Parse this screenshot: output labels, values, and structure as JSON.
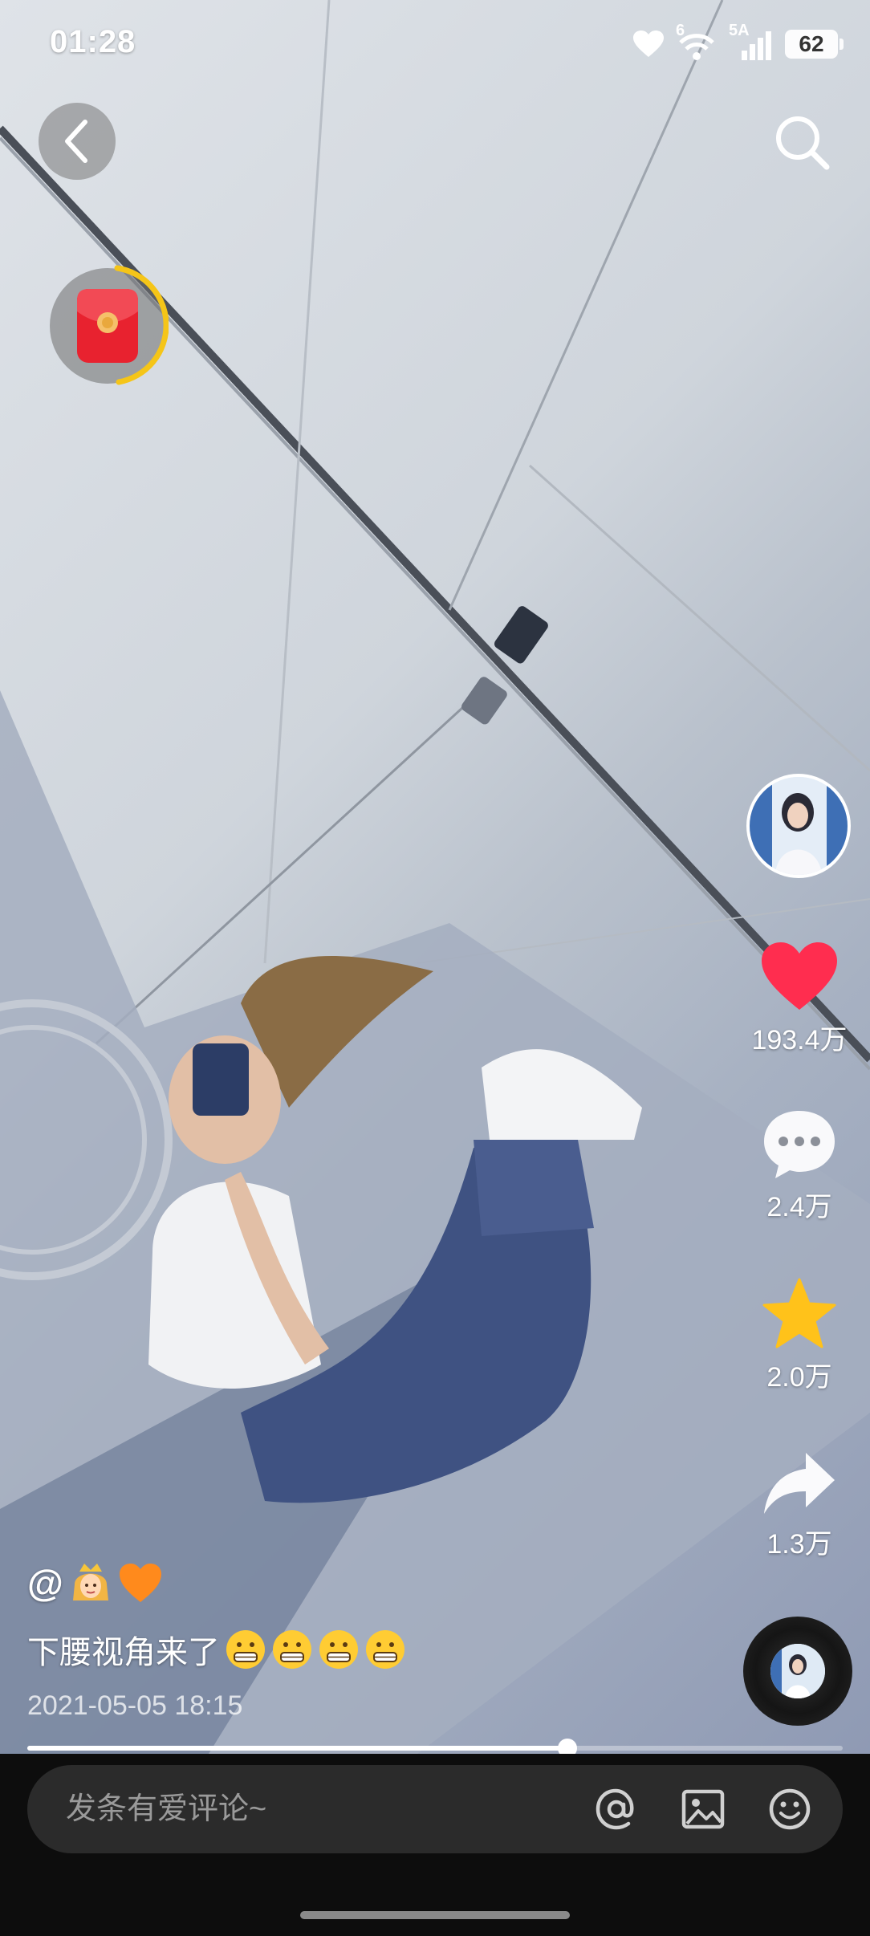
{
  "status_bar": {
    "time": "01:28",
    "network_label": "5A",
    "wifi_label": "6",
    "battery": "62"
  },
  "rail": {
    "likes": "193.4万",
    "comments": "2.4万",
    "favorites": "2.0万",
    "shares": "1.3万"
  },
  "post": {
    "author_prefix": "@",
    "author_emojis": [
      "princess-emoji",
      "orange-heart-emoji"
    ],
    "caption": "下腰视角来了",
    "caption_emojis": [
      "grimacing-face",
      "grimacing-face",
      "grimacing-face",
      "grimacing-face"
    ],
    "date": "2021-05-05 18:15"
  },
  "player": {
    "progress": 0.662
  },
  "comment_bar": {
    "placeholder": "发条有爱评论~"
  },
  "colors": {
    "like_red": "#ff2d4f",
    "star_yellow": "#ffc21a",
    "redpacket_red": "#e8222f",
    "timer_ring": "#f5c518"
  }
}
